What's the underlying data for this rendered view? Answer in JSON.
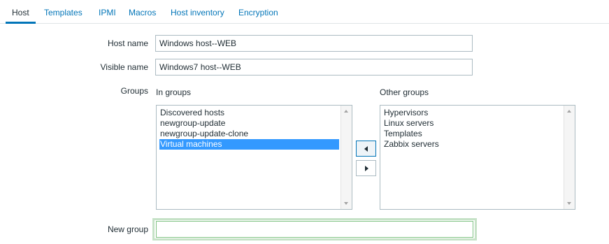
{
  "tabs": [
    {
      "label": "Host",
      "active": true
    },
    {
      "label": "Templates",
      "active": false
    },
    {
      "label": "IPMI",
      "active": false
    },
    {
      "label": "Macros",
      "active": false
    },
    {
      "label": "Host inventory",
      "active": false
    },
    {
      "label": "Encryption",
      "active": false
    }
  ],
  "form": {
    "host_name_label": "Host name",
    "host_name_value": "Windows host--WEB",
    "visible_name_label": "Visible name",
    "visible_name_value": "Windows7 host--WEB",
    "groups_label": "Groups",
    "in_groups_label": "In groups",
    "other_groups_label": "Other groups",
    "in_groups": [
      {
        "label": "Discovered hosts",
        "selected": false
      },
      {
        "label": "newgroup-update",
        "selected": false
      },
      {
        "label": "newgroup-update-clone",
        "selected": false
      },
      {
        "label": "Virtual machines",
        "selected": true
      }
    ],
    "other_groups": [
      {
        "label": "Hypervisors"
      },
      {
        "label": "Linux servers"
      },
      {
        "label": "Templates"
      },
      {
        "label": "Zabbix servers"
      }
    ],
    "new_group_label": "New group",
    "new_group_value": ""
  },
  "icons": {
    "move_left": "chevron-left-icon",
    "move_right": "chevron-right-icon"
  },
  "colors": {
    "link": "#0275b8",
    "selection": "#3399ff",
    "highlight_border": "#80c383"
  }
}
